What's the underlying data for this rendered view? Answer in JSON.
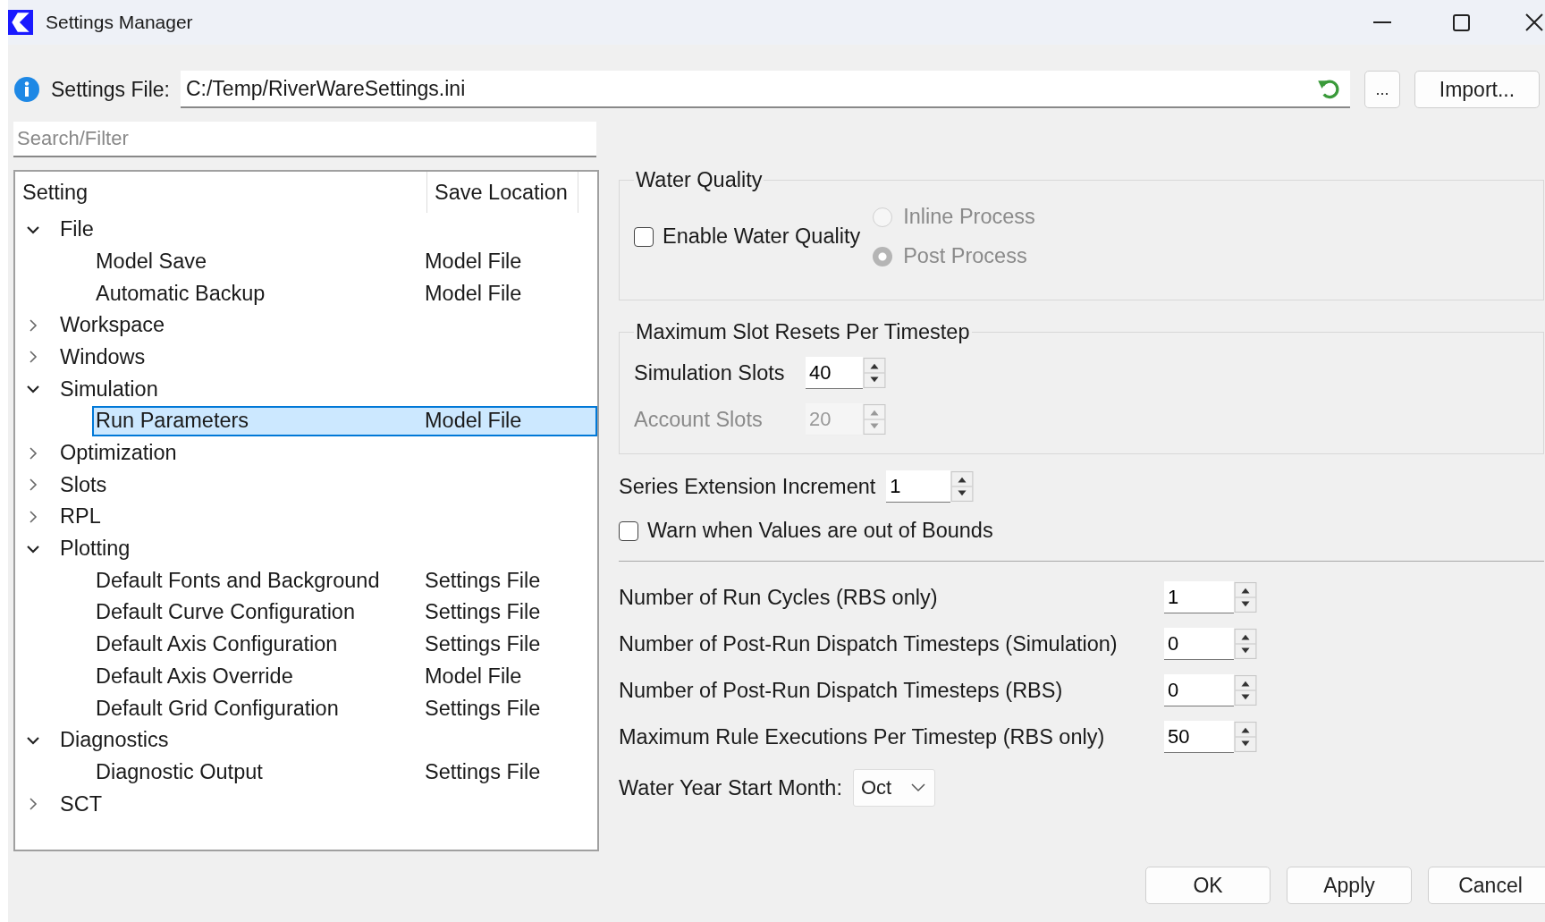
{
  "window": {
    "title": "Settings Manager"
  },
  "settings_file": {
    "label": "Settings File:",
    "value": "C:/Temp/RiverWareSettings.ini"
  },
  "file_buttons": [
    "...",
    "Import..."
  ],
  "search": {
    "placeholder": "Search/Filter"
  },
  "tree": {
    "columns": [
      "Setting",
      "Save Location"
    ],
    "items": [
      {
        "label": "File",
        "expanded": true,
        "selected": false,
        "children": [
          {
            "label": "Model Save",
            "location": "Model File",
            "selected": false
          },
          {
            "label": "Automatic Backup",
            "location": "Model File",
            "selected": false
          }
        ]
      },
      {
        "label": "Workspace",
        "expanded": false,
        "selected": false
      },
      {
        "label": "Windows",
        "expanded": false,
        "selected": false
      },
      {
        "label": "Simulation",
        "expanded": true,
        "selected": false,
        "children": [
          {
            "label": "Run Parameters",
            "location": "Model File",
            "selected": true
          }
        ]
      },
      {
        "label": "Optimization",
        "expanded": false,
        "selected": false
      },
      {
        "label": "Slots",
        "expanded": false,
        "selected": false
      },
      {
        "label": "RPL",
        "expanded": false,
        "selected": false
      },
      {
        "label": "Plotting",
        "expanded": true,
        "selected": false,
        "children": [
          {
            "label": "Default Fonts and Background",
            "location": "Settings File",
            "selected": false
          },
          {
            "label": "Default Curve Configuration",
            "location": "Settings File",
            "selected": false
          },
          {
            "label": "Default Axis Configuration",
            "location": "Settings File",
            "selected": false
          },
          {
            "label": "Default Axis Override",
            "location": "Model File",
            "selected": false
          },
          {
            "label": "Default Grid Configuration",
            "location": "Settings File",
            "selected": false
          }
        ]
      },
      {
        "label": "Diagnostics",
        "expanded": true,
        "selected": false,
        "children": [
          {
            "label": "Diagnostic Output",
            "location": "Settings File",
            "selected": false
          }
        ]
      },
      {
        "label": "SCT",
        "expanded": false,
        "selected": false
      }
    ]
  },
  "water_quality": {
    "title": "Water Quality",
    "enable": {
      "label": "Enable Water Quality",
      "checked": false
    },
    "options": [
      {
        "label": "Inline Process",
        "selected": false,
        "disabled": true
      },
      {
        "label": "Post Process",
        "selected": true,
        "disabled": true
      }
    ]
  },
  "slot_resets": {
    "title": "Maximum Slot Resets Per Timestep",
    "fields": [
      {
        "label": "Simulation Slots",
        "value": "40",
        "disabled": false
      },
      {
        "label": "Account Slots",
        "value": "20",
        "disabled": true
      }
    ]
  },
  "series_extension": {
    "label": "Series Extension Increment",
    "value": "1"
  },
  "warn_bounds": {
    "label": "Warn when Values are out of Bounds",
    "checked": false
  },
  "run_fields": [
    {
      "label": "Number of Run Cycles (RBS only)",
      "value": "1"
    },
    {
      "label": "Number of Post-Run Dispatch Timesteps (Simulation)",
      "value": "0"
    },
    {
      "label": "Number of Post-Run Dispatch Timesteps (RBS)",
      "value": "0"
    },
    {
      "label": "Maximum Rule Executions Per Timestep (RBS only)",
      "value": "50"
    }
  ],
  "water_year": {
    "label": "Water Year Start Month:",
    "value": "Oct"
  },
  "buttons": [
    "OK",
    "Apply",
    "Cancel"
  ]
}
